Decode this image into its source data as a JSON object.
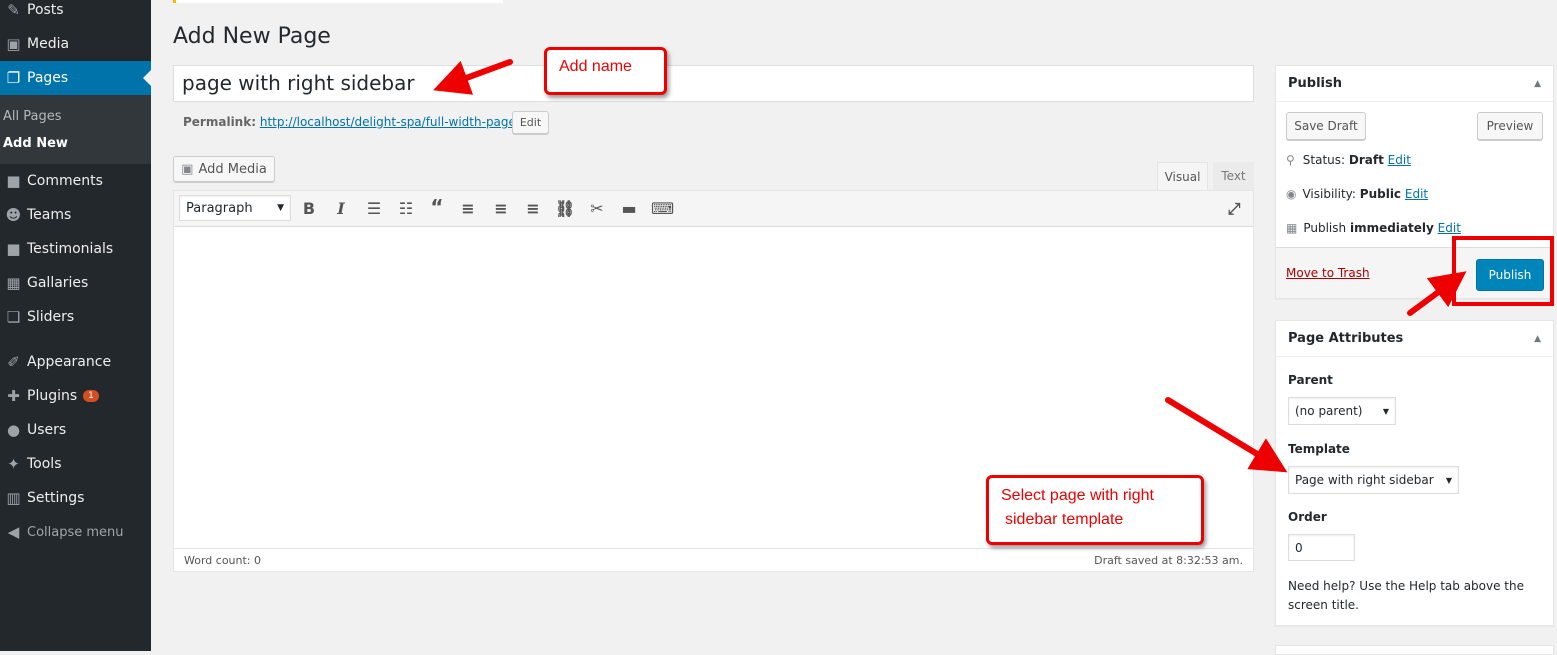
{
  "sidebar": {
    "items": [
      {
        "label": "Posts",
        "icon": "pin-icon",
        "glyph": "✎"
      },
      {
        "label": "Media",
        "icon": "media-icon",
        "glyph": "▣"
      },
      {
        "label": "Pages",
        "icon": "pages-icon",
        "glyph": "❐"
      },
      {
        "label": "Comments",
        "icon": "comment-icon",
        "glyph": "■"
      },
      {
        "label": "Teams",
        "icon": "groups-icon",
        "glyph": "☻"
      },
      {
        "label": "Testimonials",
        "icon": "testimonial-icon",
        "glyph": "■"
      },
      {
        "label": "Gallaries",
        "icon": "gallery-icon",
        "glyph": "▦"
      },
      {
        "label": "Sliders",
        "icon": "slider-icon",
        "glyph": "❏"
      },
      {
        "label": "Appearance",
        "icon": "brush-icon",
        "glyph": "✐"
      },
      {
        "label": "Plugins",
        "icon": "plugin-icon",
        "glyph": "✚",
        "badge": "1"
      },
      {
        "label": "Users",
        "icon": "user-icon",
        "glyph": "●"
      },
      {
        "label": "Tools",
        "icon": "wrench-icon",
        "glyph": "✦"
      },
      {
        "label": "Settings",
        "icon": "settings-icon",
        "glyph": "▥"
      },
      {
        "label": "Collapse menu",
        "icon": "collapse-icon",
        "glyph": "◀"
      }
    ],
    "submenu": [
      "All Pages",
      "Add New"
    ]
  },
  "main": {
    "title": "Add New Page",
    "post_title": "page with right sidebar",
    "permalink_label": "Permalink:",
    "permalink_url": "http://localhost/delight-spa/full-width-page/",
    "permalink_edit": "Edit",
    "add_media": "Add Media",
    "tab_visual": "Visual",
    "tab_text": "Text",
    "format_select": "Paragraph",
    "word_count": "Word count: 0",
    "draft_saved": "Draft saved at 8:32:53 am."
  },
  "publish": {
    "title": "Publish",
    "save_draft": "Save Draft",
    "preview": "Preview",
    "status_label": "Status:",
    "status_value": "Draft",
    "visibility_label": "Visibility:",
    "visibility_value": "Public",
    "publish_label": "Publish",
    "publish_value": "immediately",
    "edit": "Edit",
    "trash": "Move to Trash",
    "publish_button": "Publish"
  },
  "attributes": {
    "title": "Page Attributes",
    "parent_label": "Parent",
    "parent_value": "(no parent)",
    "template_label": "Template",
    "template_value": "Page with right sidebar",
    "order_label": "Order",
    "order_value": "0",
    "help": "Need help? Use the Help tab above the screen title."
  },
  "annotations": {
    "add_name": "Add name",
    "select_template_1": "Select page with right",
    "select_template_2": "sidebar template"
  },
  "colors": {
    "sidebar": "#23282d",
    "active": "#0073aa",
    "annotation": "#e00000",
    "publish_button": "#0085ba"
  }
}
